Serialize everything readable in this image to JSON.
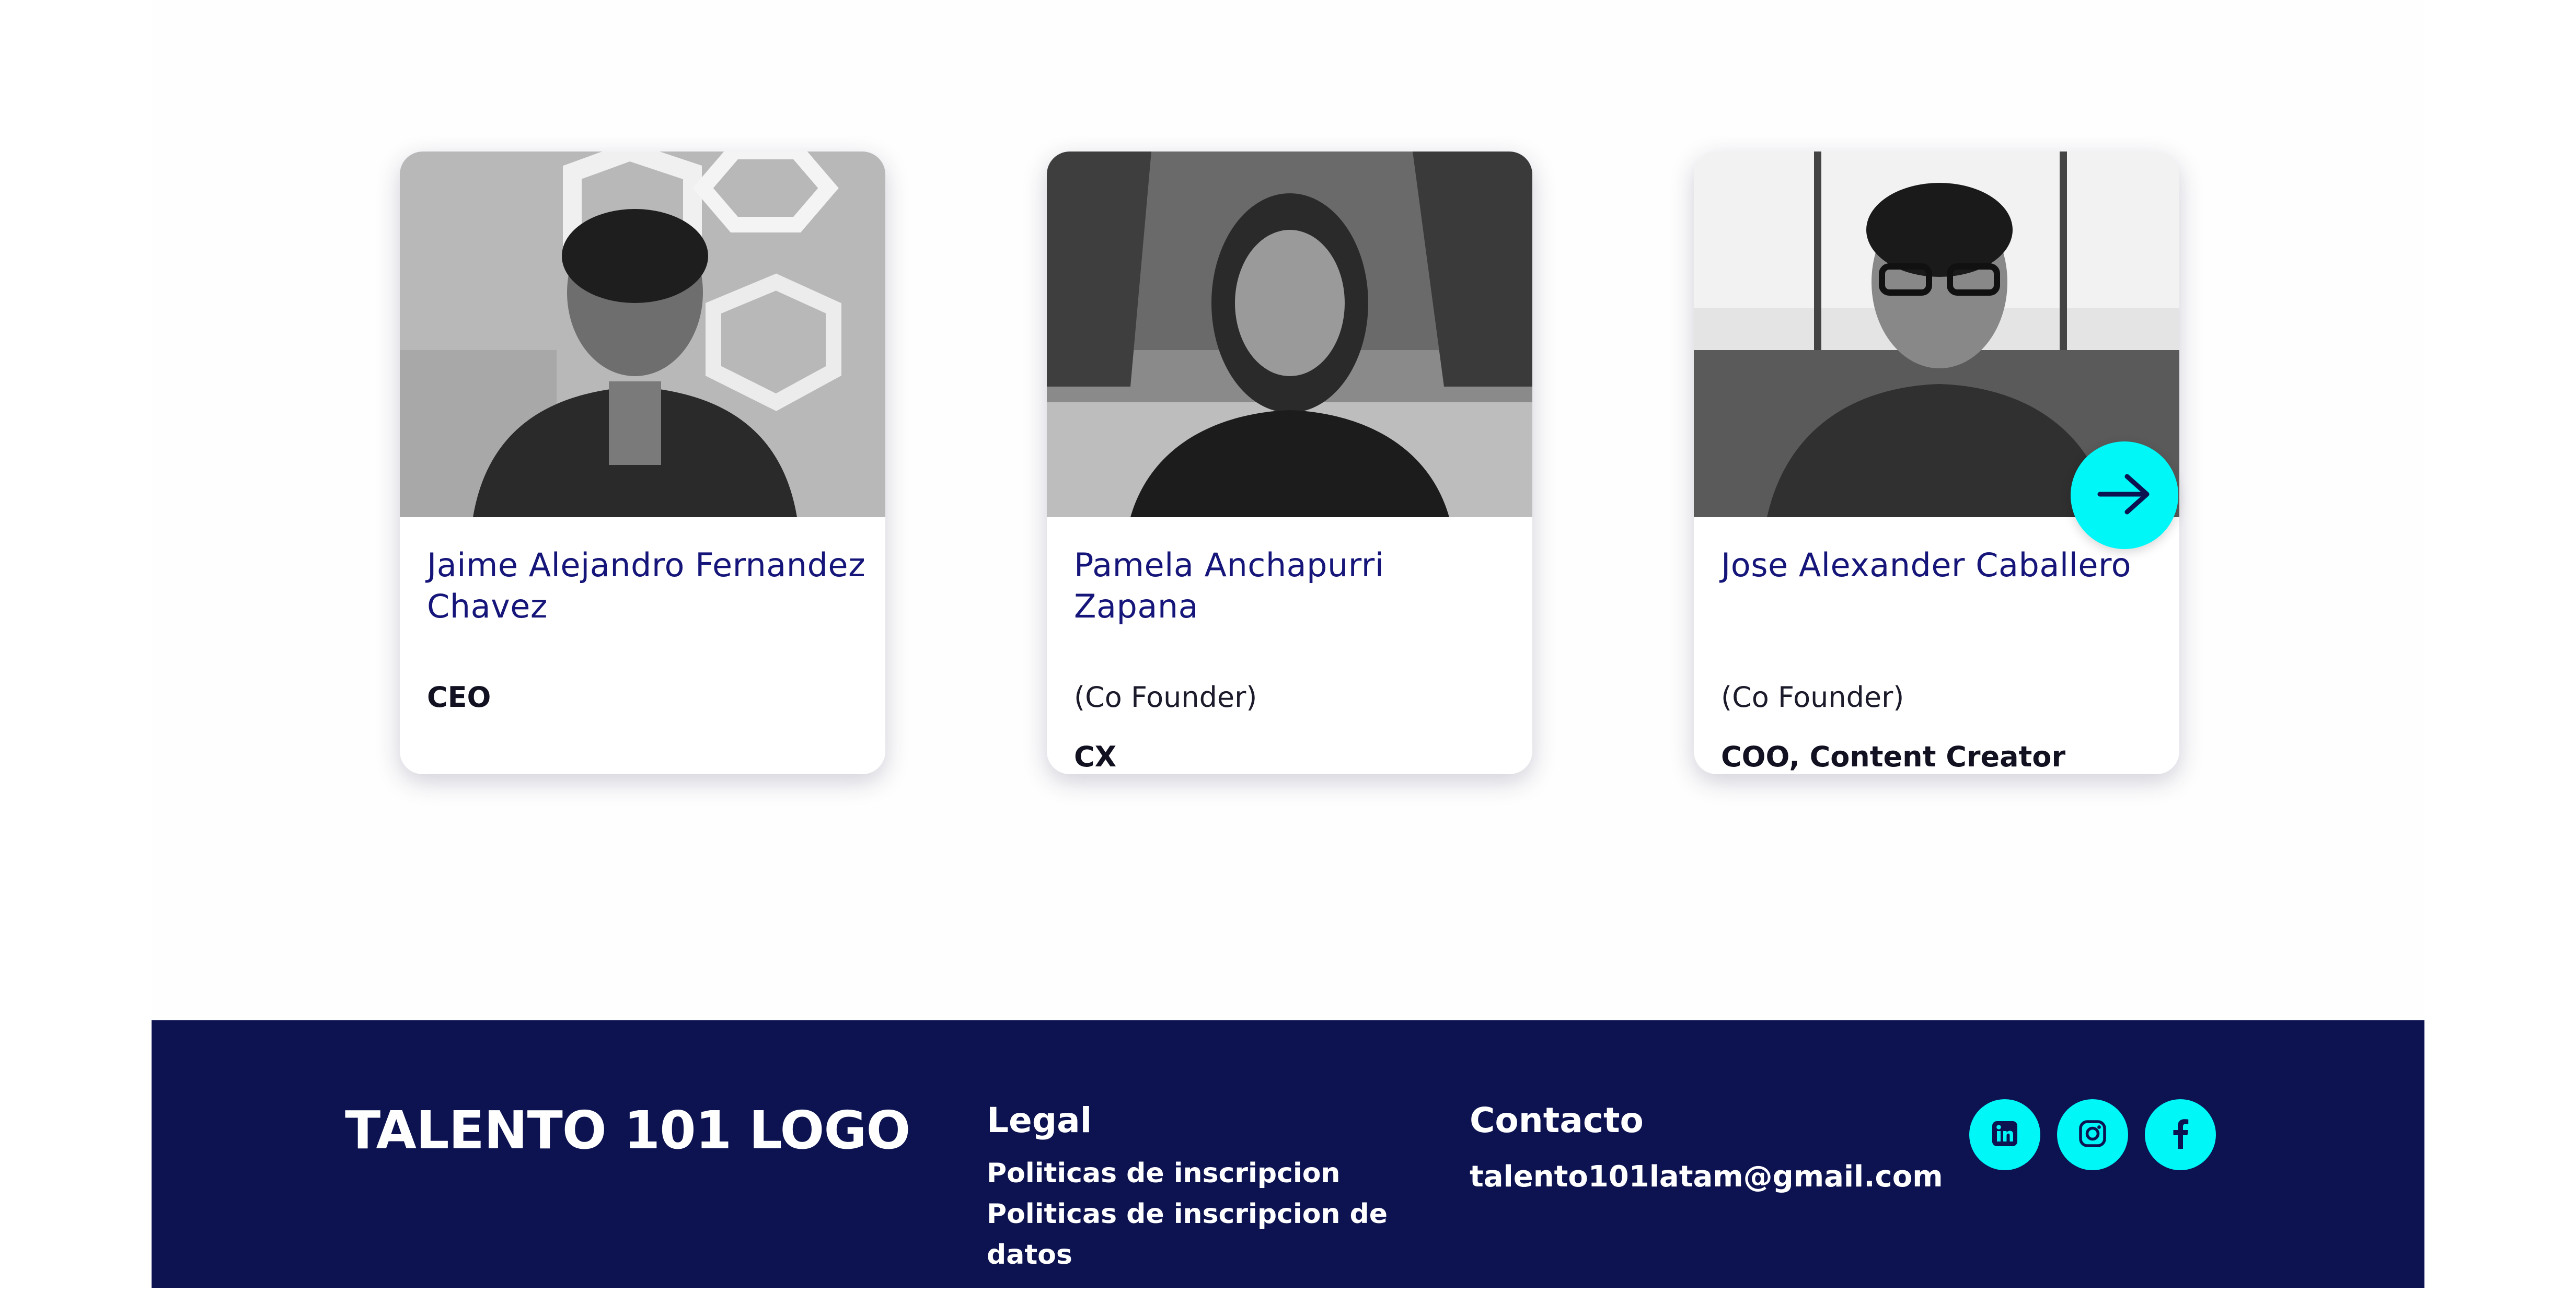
{
  "team": {
    "members": [
      {
        "name": "Jaime Alejandro Fernandez Chavez",
        "role": "",
        "position": "CEO",
        "photo": "person-portrait-photo"
      },
      {
        "name": "Pamela Anchapurri Zapana",
        "role": "(Co Founder)",
        "position": "CX",
        "photo": "person-portrait-photo"
      },
      {
        "name": "Jose Alexander Caballero",
        "role": "(Co Founder)",
        "position": "COO, Content Creator",
        "photo": "person-portrait-photo"
      }
    ],
    "next_icon": "arrow-right-icon"
  },
  "footer": {
    "logo_text": "TALENTO 101 LOGO",
    "legal": {
      "heading": "Legal",
      "links": [
        "Politicas de inscripcion",
        "Politicas de inscripcion de datos"
      ]
    },
    "contact": {
      "heading": "Contacto",
      "email": "talento101latam@gmail.com"
    },
    "social": [
      {
        "icon": "linkedin-icon"
      },
      {
        "icon": "instagram-icon"
      },
      {
        "icon": "facebook-icon"
      }
    ]
  },
  "colors": {
    "footer_bg": "#0c1350",
    "accent": "#00f7f7",
    "name_color": "#15157a"
  }
}
